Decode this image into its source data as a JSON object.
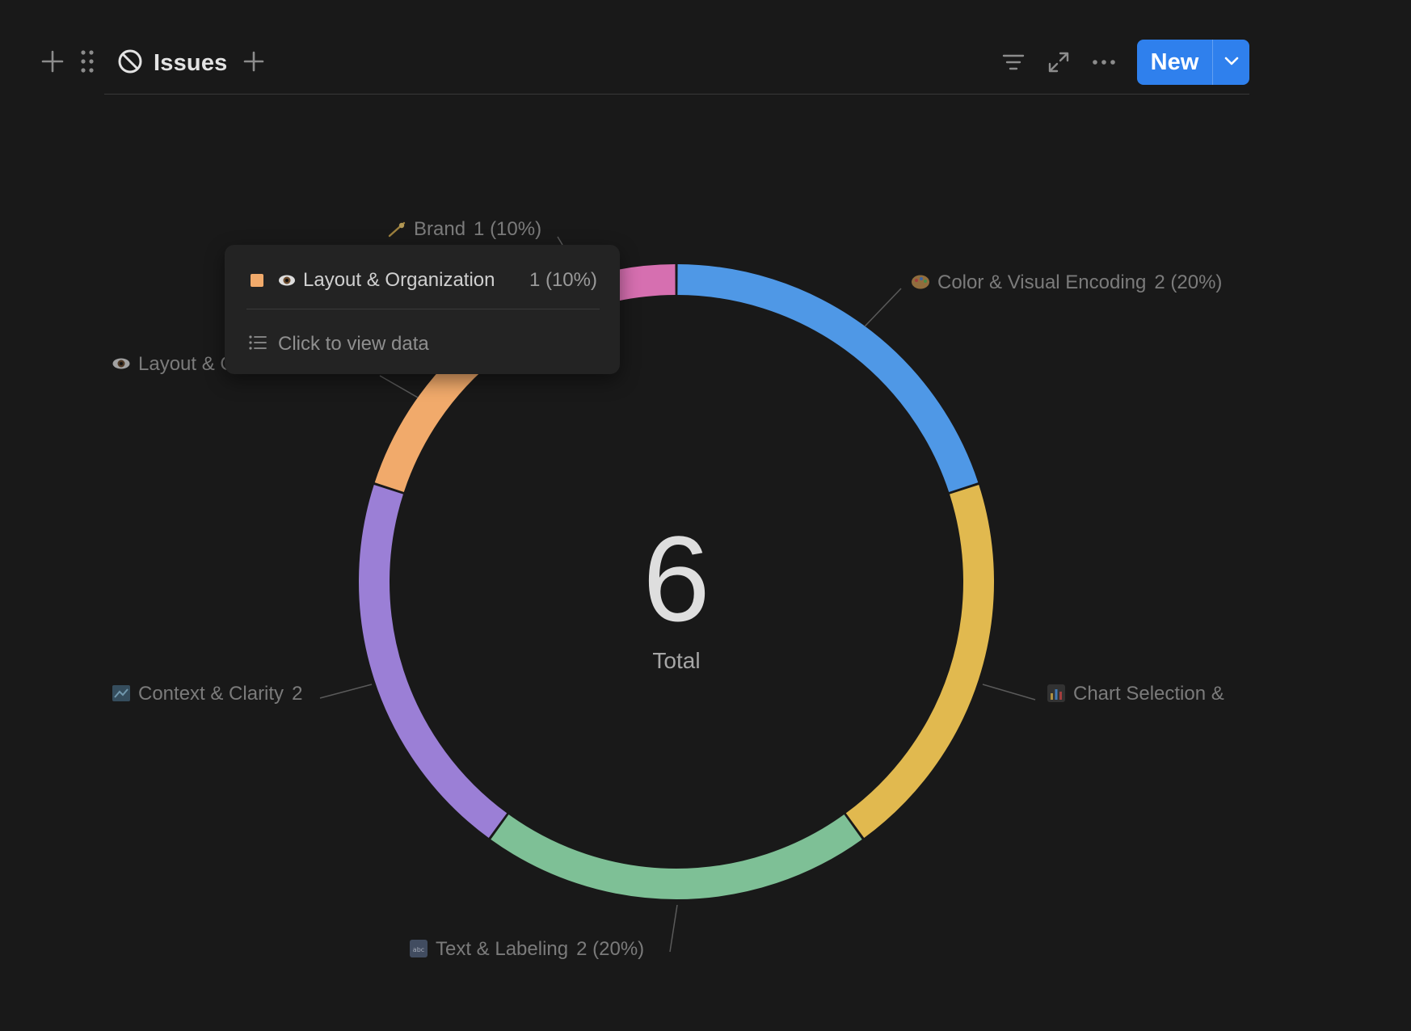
{
  "colors": {
    "accent": "#2f80ed",
    "background": "#191919",
    "segments": [
      "#d66fb0",
      "#4f98e6",
      "#e1b94f",
      "#7ec096",
      "#9b7fd6",
      "#f1aa6b"
    ]
  },
  "toolbar": {
    "view_title": "Issues",
    "view_icon": "no-entry-icon",
    "new_label": "New"
  },
  "chart_data": {
    "type": "pie",
    "variant": "donut",
    "center_value": "6",
    "center_label": "Total",
    "slices": [
      {
        "name": "Brand",
        "icon": "comet-emoji",
        "value": 1,
        "percent": "10%",
        "label": "Brand",
        "value_text": "1 (10%)",
        "color": "#d66fb0"
      },
      {
        "name": "Color & Visual Encoding",
        "icon": "palette-emoji",
        "value": 2,
        "percent": "20%",
        "label": "Color & Visual Encoding",
        "value_text": "2 (20%)",
        "color": "#4f98e6"
      },
      {
        "name": "Chart Selection",
        "icon": "bar-chart-emoji",
        "value": 2,
        "percent": "20%",
        "label": "Chart Selection & ",
        "value_text": "",
        "color": "#e1b94f"
      },
      {
        "name": "Text & Labeling",
        "icon": "abc-emoji",
        "value": 2,
        "percent": "20%",
        "label": "Text & Labeling",
        "value_text": "2 (20%)",
        "color": "#7ec096"
      },
      {
        "name": "Context & Clarity",
        "icon": "map-emoji",
        "value": 2,
        "percent": "20%",
        "label": "Context & Clarity",
        "value_text": "2",
        "color": "#9b7fd6"
      },
      {
        "name": "Layout & Organization",
        "icon": "eye-emoji",
        "value": 1,
        "percent": "10%",
        "label": "Layout & Organization",
        "value_text": "1",
        "color": "#f1aa6b"
      }
    ]
  },
  "tooltip": {
    "name": "Layout & Organization",
    "value": "1 (10%)",
    "link_label": "Click to view data",
    "color": "#f1aa6b",
    "icon": "eye-emoji"
  }
}
